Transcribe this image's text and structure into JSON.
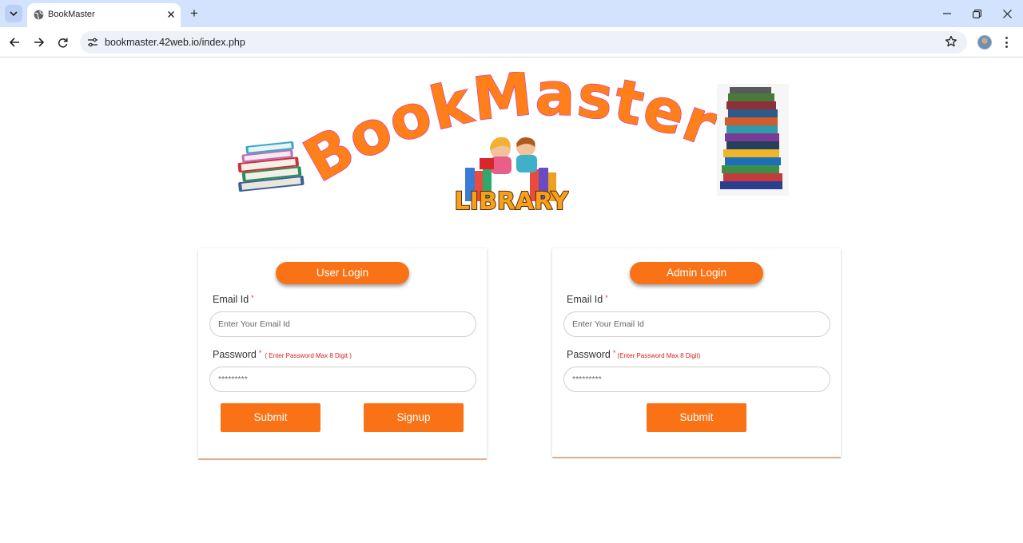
{
  "browser": {
    "tab_title": "BookMaster",
    "url": "bookmaster.42web.io/index.php"
  },
  "banner": {
    "title": "BookMaster",
    "library_text": "LIBRARY"
  },
  "user_card": {
    "heading": "User Login",
    "email_label": "Email Id",
    "email_placeholder": "Enter Your Email Id",
    "password_label": "Password",
    "password_hint": "( Enter Password Max 8 Digit )",
    "password_placeholder": "*********",
    "submit_label": "Submit",
    "signup_label": "Signup"
  },
  "admin_card": {
    "heading": "Admin Login",
    "email_label": "Email Id",
    "email_placeholder": "Enter Your Email Id",
    "password_label": "Password",
    "password_hint": "(Enter Password Max 8 Digit)",
    "password_placeholder": "*********",
    "submit_label": "Submit"
  },
  "required_mark": "*",
  "colors": {
    "accent": "#f97316",
    "title_outline": "#e040a0",
    "tabbar": "#d3e3fd"
  },
  "icons": [
    "tab-list-icon",
    "globe-icon",
    "close-icon",
    "plus-icon",
    "minimize-icon",
    "restore-icon",
    "window-close-icon",
    "back-icon",
    "forward-icon",
    "reload-icon",
    "site-settings-icon",
    "bookmark-star-icon",
    "profile-avatar",
    "more-menu-icon"
  ]
}
